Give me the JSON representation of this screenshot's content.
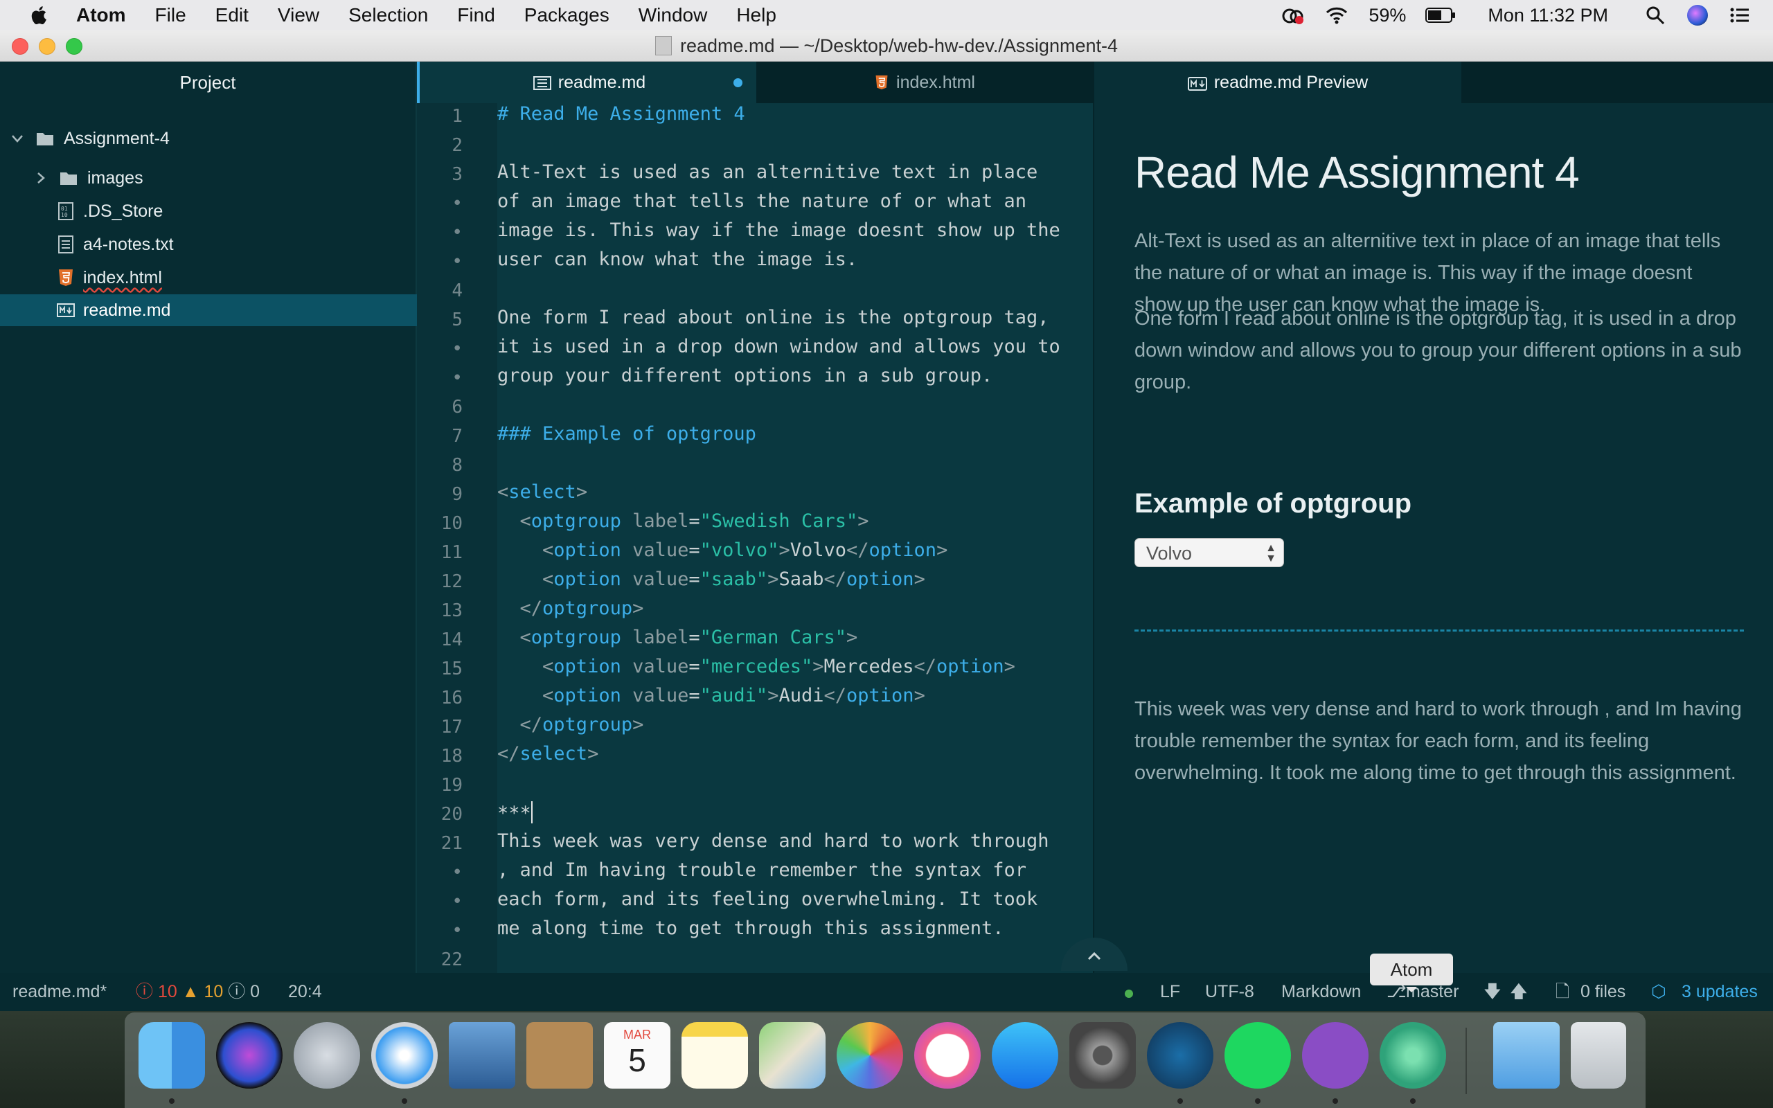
{
  "menubar": {
    "items": [
      "Atom",
      "File",
      "Edit",
      "View",
      "Selection",
      "Find",
      "Packages",
      "Window",
      "Help"
    ],
    "battery": "59%",
    "clock": "Mon 11:32 PM"
  },
  "window": {
    "title": "readme.md — ~/Desktop/web-hw-dev./Assignment-4"
  },
  "sidebar": {
    "header": "Project",
    "root": "Assignment-4",
    "items": [
      {
        "label": "images",
        "icon": "folder-icon"
      },
      {
        "label": ".DS_Store",
        "icon": "binary-file-icon"
      },
      {
        "label": "a4-notes.txt",
        "icon": "text-file-icon"
      },
      {
        "label": "index.html",
        "icon": "html5-icon"
      },
      {
        "label": "readme.md",
        "icon": "markdown-file-icon"
      }
    ]
  },
  "tabs": [
    {
      "label": "readme.md",
      "icon": "markdown-icon",
      "modified": true
    },
    {
      "label": "index.html",
      "icon": "html5-icon"
    },
    {
      "label": "readme.md Preview",
      "icon": "markdown-preview-icon"
    }
  ],
  "editor": {
    "line_numbers": [
      "1",
      "2",
      "3",
      "•",
      "•",
      "•",
      "4",
      "5",
      "•",
      "•",
      "6",
      "7",
      "8",
      "9",
      "10",
      "11",
      "12",
      "13",
      "14",
      "15",
      "16",
      "17",
      "18",
      "19",
      "20",
      "21",
      "•",
      "•",
      "•",
      "22"
    ],
    "lines": [
      "# Read Me Assignment 4",
      "",
      "Alt-Text is used as an alternitive text in place",
      "of an image that tells the nature of or what an",
      "image is. This way if the image doesnt show up the",
      "user can know what the image is.",
      "",
      "One form I read about online is the optgroup tag,",
      "it is used in a drop down window and allows you to",
      "group your different options in a sub group.",
      "",
      "### Example of optgroup",
      "",
      "<select>",
      "  <optgroup label=\"Swedish Cars\">",
      "    <option value=\"volvo\">Volvo</option>",
      "    <option value=\"saab\">Saab</option>",
      "  </optgroup>",
      "  <optgroup label=\"German Cars\">",
      "    <option value=\"mercedes\">Mercedes</option>",
      "    <option value=\"audi\">Audi</option>",
      "  </optgroup>",
      "</select>",
      "",
      "***",
      "This week was very dense and hard to work through",
      ", and Im having trouble remember the syntax for",
      "each form, and its feeling overwhelming. It took",
      "me along time to get through this assignment.",
      ""
    ]
  },
  "preview": {
    "title": "Read Me Assignment 4",
    "paragraphs": [
      "Alt-Text is used as an alternitive text in place of an image that tells the nature of or what an image is. This way if the image doesnt show up the user can know what the image is.",
      "One form I read about online is the optgroup tag, it is used in a drop down window and allows you to group your different options in a sub group."
    ],
    "heading": "Example of optgroup",
    "select_value": "Volvo",
    "closing": "This week was very dense and hard to work through , and Im having trouble remember the syntax for each form, and its feeling overwhelming. It took me along time to get through this assignment."
  },
  "statusbar": {
    "file": "readme.md*",
    "errors": "10",
    "warnings": "10",
    "infos": "0",
    "cursor": "20:4",
    "line_ending": "LF",
    "encoding": "UTF-8",
    "grammar": "Markdown",
    "branch": "master",
    "files": "0 files",
    "updates": "3 updates"
  },
  "dock": {
    "tooltip": "Atom",
    "calendar_month": "MAR",
    "calendar_day": "5"
  },
  "colors": {
    "accent": "#3daee9",
    "selection": "#0c5264",
    "error": "#e2493d",
    "warning": "#e6a130",
    "status_ok": "#4caf50"
  }
}
